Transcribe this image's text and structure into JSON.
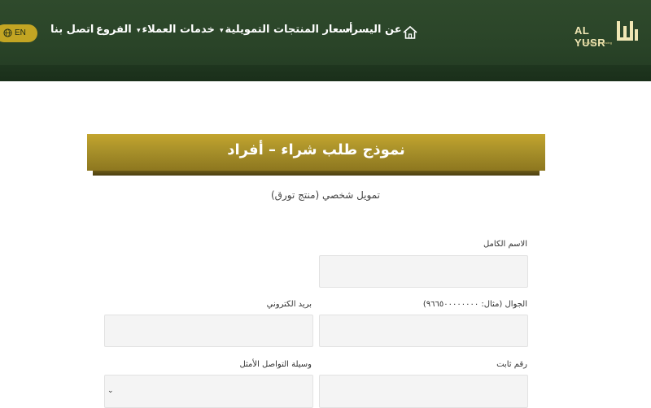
{
  "header": {
    "logo_text": "AL YUSR",
    "logo_sub": "Leasing & Financing",
    "nav": [
      {
        "label": "عن اليسر",
        "dropdown": true
      },
      {
        "label": "أسعار المنتجات التمويلية",
        "dropdown": true
      },
      {
        "label": "خدمات العملاء",
        "dropdown": true
      },
      {
        "label": "الفروع",
        "dropdown": false
      },
      {
        "label": "اتصل بنا",
        "dropdown": false
      }
    ],
    "lang_label": "EN",
    "caret": "▾"
  },
  "banner": {
    "title": "نموذج طلب شراء – أفراد"
  },
  "subtitle": "تمويل شخصي (منتج تورق)",
  "form": {
    "full_name_label": "الاسم الكامل",
    "mobile_label": "الجوال (مثال: ٩٦٦٥٠٠٠٠٠٠٠٠)",
    "email_label": "بريد الكتروني",
    "landline_label": "رقم ثابت",
    "contact_method_label": "وسيلة التواصل الأمثل",
    "select_caret": "⌄"
  },
  "colors": {
    "header_bg": "#2a4428",
    "gold": "#c3a523",
    "banner": "#a8902a"
  }
}
